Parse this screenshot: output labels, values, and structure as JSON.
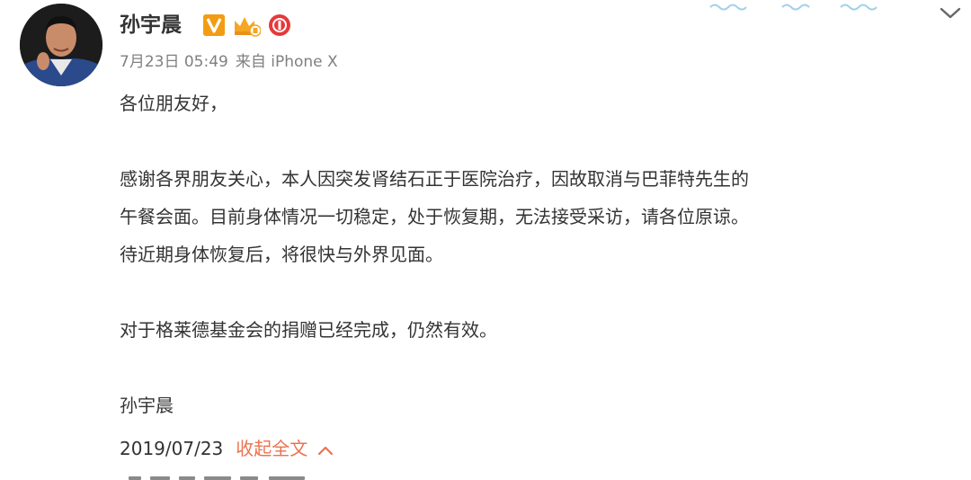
{
  "post": {
    "author": "孙宇晨",
    "date": "7月23日 05:49",
    "source": "来自 iPhone X",
    "paragraphs": [
      "各位朋友好，",
      "感谢各界朋友关心，本人因突发肾结石正于医院治疗，因故取消与巴菲特先生的",
      "午餐会面。目前身体情况一切稳定，处于恢复期，无法接受采访，请各位原谅。",
      "待近期身体恢复后，将很快与外界见面。",
      "对于格莱德基金会的捐赠已经完成，仍然有效。",
      "孙宇晨"
    ],
    "signature_date": "2019/07/23",
    "collapse_label": "收起全文"
  },
  "icons": {
    "verified": "verified-v-icon",
    "member": "crown-member-icon",
    "badge": "red-badge-icon",
    "menu": "chevron-down-icon",
    "collapse": "chevron-up-icon"
  },
  "colors": {
    "accent": "#eb7350",
    "verified": "#f39c12",
    "text": "#333333",
    "meta": "#808080"
  }
}
